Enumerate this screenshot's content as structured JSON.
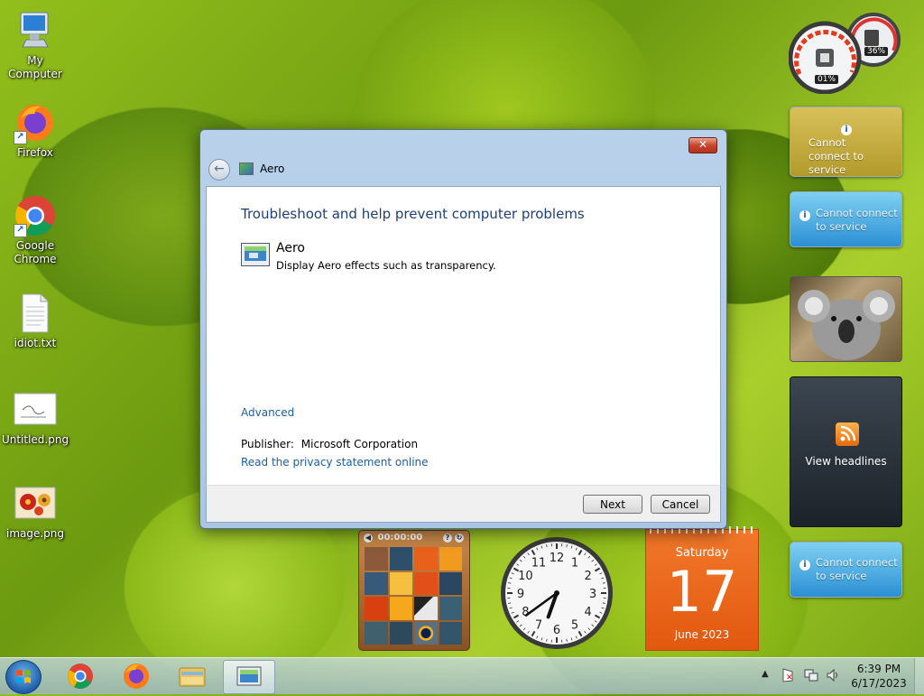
{
  "desktop": {
    "icons": [
      {
        "label": "My Computer"
      },
      {
        "label": "Firefox"
      },
      {
        "label": "Google Chrome"
      },
      {
        "label": "idiot.txt"
      },
      {
        "label": "Untitled.png"
      },
      {
        "label": "image.png"
      }
    ]
  },
  "gadgets": {
    "meter": {
      "cpu": "01%",
      "memory": "36%"
    },
    "weather_msg": "Cannot connect to service",
    "feed": {
      "label": "View headlines"
    },
    "puzzle": {
      "timer": "00:00:00"
    },
    "clock": {
      "hour": 6,
      "minute": 39
    },
    "calendar": {
      "weekday": "Saturday",
      "day": "17",
      "month_year": "June 2023"
    }
  },
  "dialog": {
    "window_title": "Aero",
    "heading": "Troubleshoot and help prevent computer problems",
    "item_title": "Aero",
    "item_desc": "Display Aero effects such as transparency.",
    "advanced_link": "Advanced",
    "publisher_label": "Publisher:",
    "publisher_value": "Microsoft Corporation",
    "privacy_link": "Read the privacy statement online",
    "next_label": "Next",
    "cancel_label": "Cancel"
  },
  "taskbar": {
    "time": "6:39 PM",
    "date": "6/17/2023"
  },
  "colors": {
    "link": "#1c5fa8",
    "heading": "#1e3f7a",
    "calendar": "#e8631a"
  }
}
